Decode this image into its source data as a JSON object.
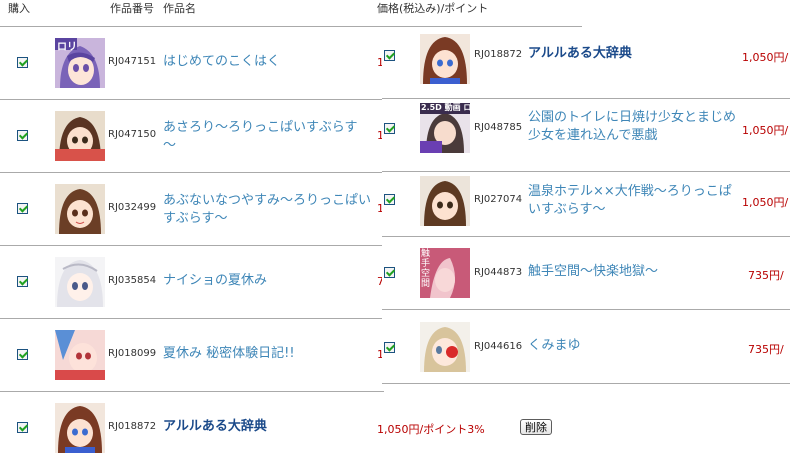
{
  "header": {
    "purchase": "購入",
    "product_number": "作品番号",
    "product_name": "作品名",
    "price": "価格(税込み)/ポイント"
  },
  "cart_items": [
    {
      "code": "RJ047151",
      "title": "はじめてのこくはく",
      "checked": true,
      "thumb_label": "ロリ",
      "price_fragment": "1"
    },
    {
      "code": "RJ047150",
      "title": "あさろり～ろりっこぱいすぶらす～",
      "checked": true,
      "price_fragment": "1"
    },
    {
      "code": "RJ032499",
      "title": "あぶないなつやすみ～ろりっこぱいすぶらす～",
      "checked": true,
      "price_fragment": "1"
    },
    {
      "code": "RJ035854",
      "title": "ナイショの夏休み",
      "checked": true,
      "price_fragment": "7"
    },
    {
      "code": "RJ018099",
      "title": "夏休み 秘密体験日記!!",
      "checked": true,
      "price_fragment": "1"
    },
    {
      "code": "RJ018872",
      "title": "アルルある大辞典",
      "checked": true,
      "price": "1,050円/ポイント3%",
      "delete_label": "削除"
    }
  ],
  "overlay_items": [
    {
      "code": "RJ018872",
      "title": "アルルある大辞典",
      "checked": true,
      "price": "1,050円/"
    },
    {
      "code": "RJ048785",
      "title": "公園のトイレに日焼け少女とまじめ少女を連れ込んで悪戯",
      "checked": true,
      "price": "1,050円/",
      "thumb_label": "2.5D 動画 ロリ動画"
    },
    {
      "code": "RJ027074",
      "title": "温泉ホテル××大作戦～ろりっこぱいすぶらす～",
      "checked": true,
      "price": "1,050円/"
    },
    {
      "code": "RJ044873",
      "title": "触手空間～快楽地獄～",
      "checked": true,
      "price": "735円/",
      "thumb_label": "触手空間"
    },
    {
      "code": "RJ044616",
      "title": "くみまゆ",
      "checked": true,
      "price": "735円/"
    }
  ],
  "colors": {
    "link": "#3e86b7",
    "link_bold": "#1b4a8a",
    "price": "#b80000",
    "check": "#21a121"
  }
}
